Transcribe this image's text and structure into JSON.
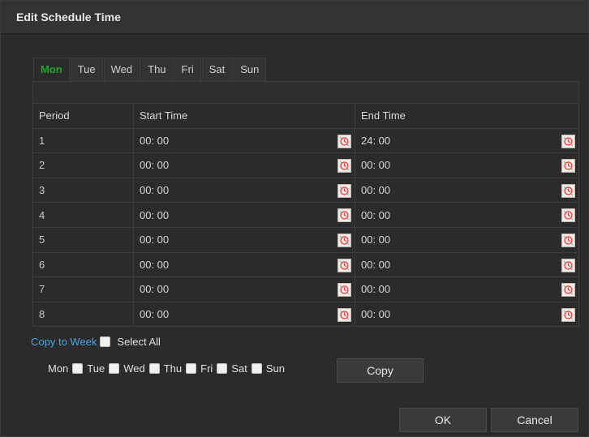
{
  "dialog": {
    "title": "Edit Schedule Time"
  },
  "tabs": [
    {
      "label": "Mon",
      "active": true
    },
    {
      "label": "Tue",
      "active": false
    },
    {
      "label": "Wed",
      "active": false
    },
    {
      "label": "Thu",
      "active": false
    },
    {
      "label": "Fri",
      "active": false
    },
    {
      "label": "Sat",
      "active": false
    },
    {
      "label": "Sun",
      "active": false
    }
  ],
  "table": {
    "headers": {
      "period": "Period",
      "start": "Start Time",
      "end": "End Time"
    },
    "rows": [
      {
        "period": "1",
        "start": "00: 00",
        "end": "24: 00"
      },
      {
        "period": "2",
        "start": "00: 00",
        "end": "00: 00"
      },
      {
        "period": "3",
        "start": "00: 00",
        "end": "00: 00"
      },
      {
        "period": "4",
        "start": "00: 00",
        "end": "00: 00"
      },
      {
        "period": "5",
        "start": "00: 00",
        "end": "00: 00"
      },
      {
        "period": "6",
        "start": "00: 00",
        "end": "00: 00"
      },
      {
        "period": "7",
        "start": "00: 00",
        "end": "00: 00"
      },
      {
        "period": "8",
        "start": "00: 00",
        "end": "00: 00"
      }
    ]
  },
  "copy": {
    "link_label": "Copy to Week",
    "select_all_label": "Select All",
    "days": [
      "Mon",
      "Tue",
      "Wed",
      "Thu",
      "Fri",
      "Sat",
      "Sun"
    ],
    "copy_button": "Copy"
  },
  "footer": {
    "ok": "OK",
    "cancel": "Cancel"
  },
  "colors": {
    "active_tab": "#22a422",
    "link": "#4aa3df"
  },
  "icons": {
    "time_picker": "clock-icon"
  }
}
